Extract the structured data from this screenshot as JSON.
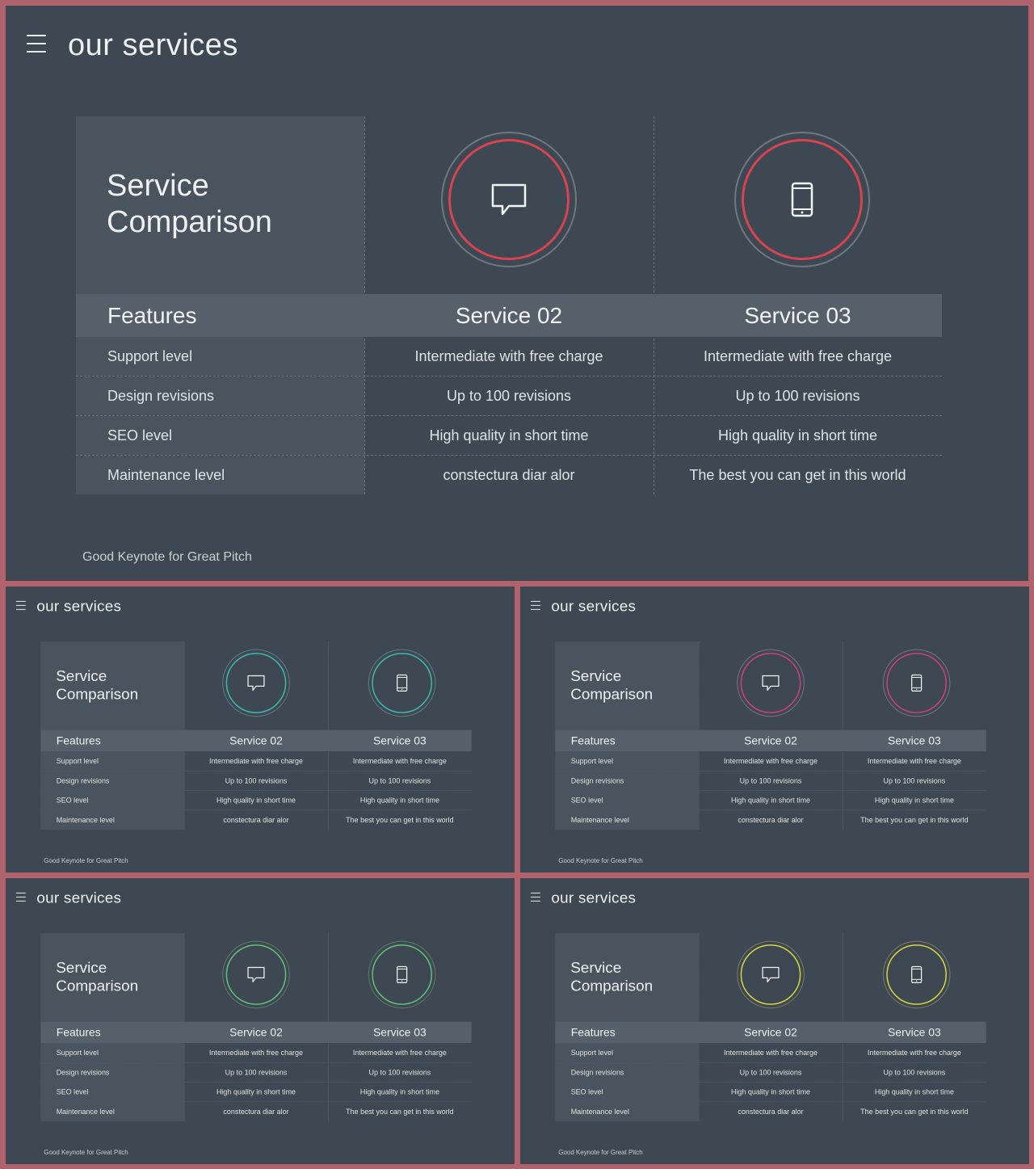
{
  "slide": {
    "title": "our services",
    "compare_title": "Service Comparison",
    "footer": "Good Keynote for Great Pitch",
    "headers": {
      "col1": "Features",
      "col2": "Service 02",
      "col3": "Service 03"
    },
    "rows": [
      {
        "feature": "Support level",
        "s2": "Intermediate  with  free  charge",
        "s3": "Intermediate  with  free  charge"
      },
      {
        "feature": "Design revisions",
        "s2": "Up  to  100 revisions",
        "s3": "Up  to  100 revisions"
      },
      {
        "feature": "SEO level",
        "s2": "High  quality  in  short  time",
        "s3": "High  quality  in  short  time"
      },
      {
        "feature": "Maintenance  level",
        "s2": "constectura  diar  alor",
        "s3": "The  best  you  can  get  in  this  world"
      }
    ]
  },
  "icons": {
    "service2": "chat-bubble-icon",
    "service3": "mobile-phone-icon",
    "menu": "hamburger-menu-icon"
  },
  "variants": [
    {
      "name": "red",
      "accent": "#d84352",
      "ring": "#6e7882"
    },
    {
      "name": "teal",
      "accent": "#3fb8ad",
      "ring": "#5f7b80"
    },
    {
      "name": "magenta",
      "accent": "#cf3f7c",
      "ring": "#7b6f85"
    },
    {
      "name": "green",
      "accent": "#62c07a",
      "ring": "#5f7a66"
    },
    {
      "name": "yellow",
      "accent": "#d8d53e",
      "ring": "#7a7a62"
    }
  ]
}
